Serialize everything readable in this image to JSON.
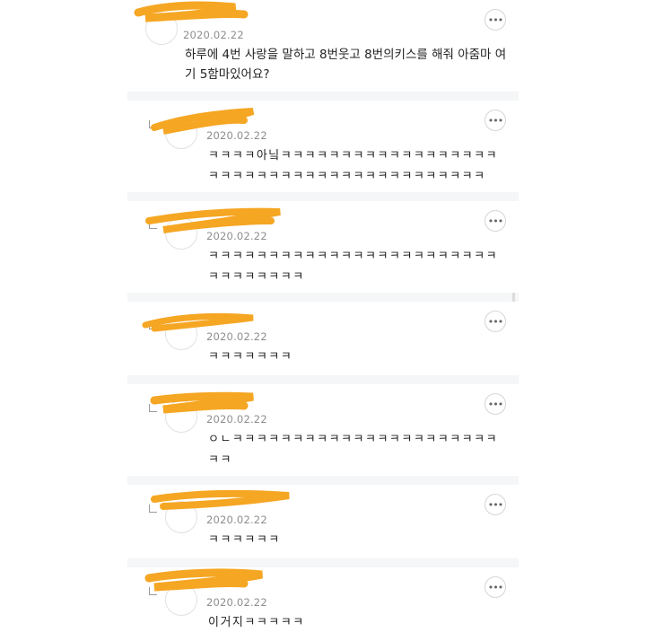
{
  "comments": [
    {
      "date": "2020.02.22",
      "text": "하루에 4번 사랑을 말하고 8번웃고 8번의키스를 해줘 아줌마 여기 5함마있어요?"
    },
    {
      "date": "2020.02.22",
      "text": "ㅋㅋㅋㅋ아닠ㅋㅋㅋㅋㅋㅋㅋㅋㅋㅋㅋㅋㅋㅋㅋㅋㅋㅋㅋㅋㅋㅋㅋㅋㅋㅋㅋㅋㅋㅋㅋㅋㅋㅋㅋㅋㅋㅋㅋㅋㅋ"
    },
    {
      "date": "2020.02.22",
      "text": "ㅋㅋㅋㅋㅋㅋㅋㅋㅋㅋㅋㅋㅋㅋㅋㅋㅋㅋㅋㅋㅋㅋㅋㅋㅋㅋㅋㅋㅋㅋㅋㅋ"
    },
    {
      "date": "2020.02.22",
      "text": "ㅋㅋㅋㅋㅋㅋㅋ"
    },
    {
      "date": "2020.02.22",
      "text": "ㅇㄴㅋㅋㅋㅋㅋㅋㅋㅋㅋㅋㅋㅋㅋㅋㅋㅋㅋㅋㅋㅋㅋㅋㅋㅋ"
    },
    {
      "date": "2020.02.22",
      "text": "ㅋㅋㅋㅋㅋㅋ"
    },
    {
      "date": "2020.02.22",
      "text": "이거지ㅋㅋㅋㅋㅋ"
    }
  ],
  "icons": {
    "more": "more-options-icon",
    "reply": "reply-indicator-icon",
    "avatar": "avatar"
  },
  "colors": {
    "redaction": "#f5a623",
    "date": "#8e8e8e",
    "background": "#f5f6f7"
  }
}
